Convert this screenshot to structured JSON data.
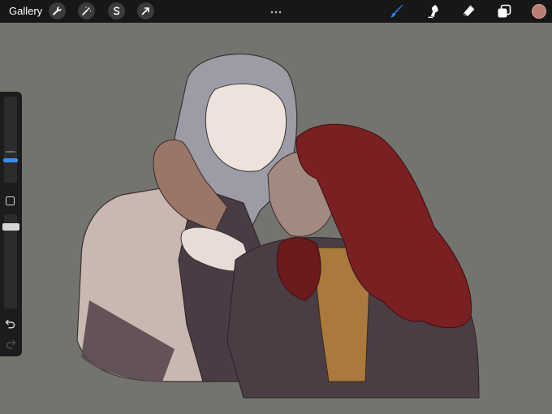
{
  "toolbar": {
    "gallery_label": "Gallery",
    "left_tools": [
      {
        "name": "wrench-icon"
      },
      {
        "name": "magic-wand-icon"
      },
      {
        "name": "selection-icon"
      },
      {
        "name": "transform-arrow-icon"
      }
    ],
    "right_tools": [
      {
        "name": "brush-icon",
        "active": true
      },
      {
        "name": "smudge-icon",
        "active": false
      },
      {
        "name": "eraser-icon",
        "active": false
      },
      {
        "name": "layers-icon",
        "active": false
      }
    ],
    "current_color": "#b97e73",
    "active_tool_color": "#2f7df6"
  },
  "sidebar": {
    "brush_size_level": 0.25,
    "opacity_level": 1.0,
    "icons": [
      "modify-square-icon",
      "undo-icon",
      "redo-icon"
    ]
  },
  "canvas": {
    "background_color": "#74746f"
  }
}
